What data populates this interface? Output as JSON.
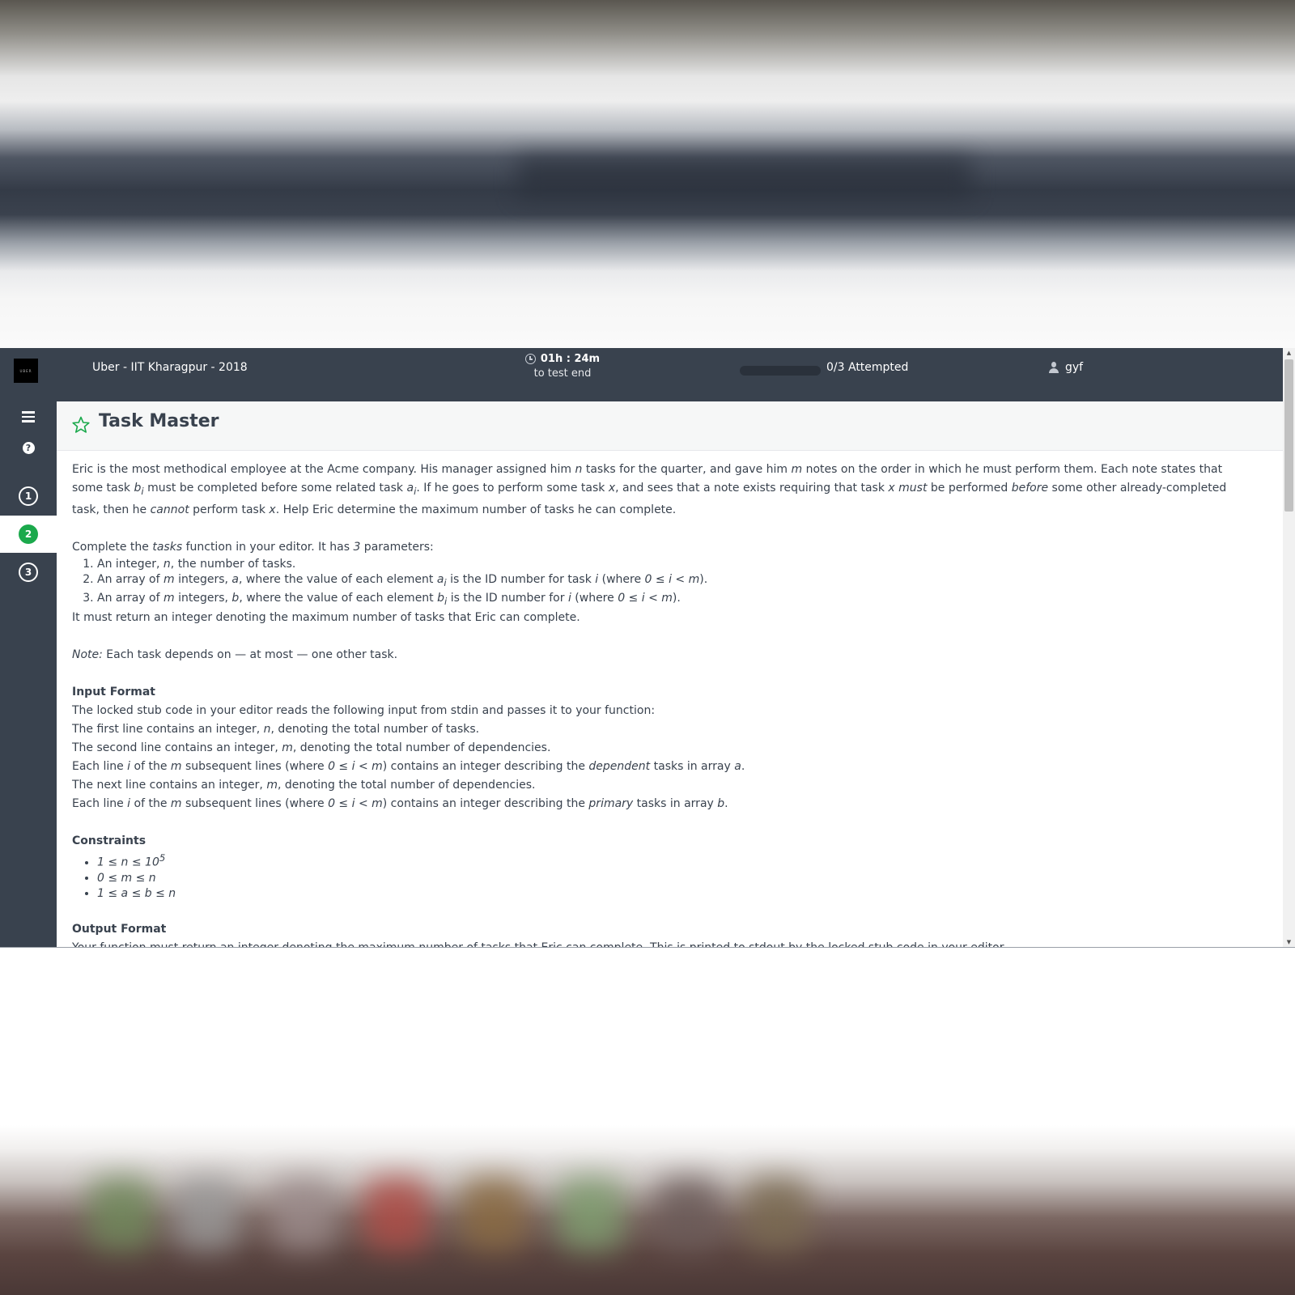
{
  "header": {
    "logo_text": "UBER",
    "contest_title": "Uber - IIT Kharagpur - 2018",
    "timer_value": "01h : 24m",
    "timer_label": "to test end",
    "progress_fraction": 0.0,
    "attempted_label": "0/3 Attempted",
    "username": "gyf"
  },
  "sidebar": {
    "questions": [
      {
        "label": "1",
        "active": false
      },
      {
        "label": "2",
        "active": true
      },
      {
        "label": "3",
        "active": false
      }
    ]
  },
  "challenge": {
    "title": "Task Master",
    "intro": {
      "t1": "Eric is the most methodical employee at the Acme company. His manager assigned him ",
      "n": "n",
      "t2": " tasks for the quarter, and gave him ",
      "m": "m",
      "t3": " notes on the order in which he must perform them. Each note states that some task ",
      "b": "b",
      "i": "i",
      "t4": " must be completed before some related task ",
      "a": "a",
      "t5": ". If he goes to perform some task ",
      "x": "x",
      "t6": ", and sees that a note exists requiring that task ",
      "must": "must",
      "t7": " be performed ",
      "before": "before",
      "t8": " some other already-completed task, then he ",
      "cannot": "cannot",
      "t9": " perform task ",
      "t10": ". Help Eric determine the maximum number of tasks he can complete."
    },
    "complete": {
      "t1": "Complete the ",
      "fn": "tasks",
      "t2": " function in your editor. It has ",
      "count": "3",
      "t3": " parameters:"
    },
    "params": {
      "p1a": "An integer, ",
      "p1b": ", the number of tasks.",
      "p2a": "An array of ",
      "p2b": " integers, ",
      "p2c": ", where the value of each element ",
      "p2d": " is the ID number for task ",
      "p2e": " (where ",
      "range": "0 ≤ i < m",
      "close": ").",
      "p3a": "An array of ",
      "p3b": " integers, ",
      "p3c": ", where the value of each element ",
      "p3d": " is the ID number for ",
      "p3e": " (where "
    },
    "returns": "It must return an integer denoting the maximum number of tasks that Eric can complete.",
    "note_label": "Note:",
    "note_text": " Each task depends on — at most — one other task.",
    "input_format": {
      "title": "Input Format",
      "l1": "The locked stub code in your editor reads the following input from stdin and passes it to your function:",
      "l2a": "The first line contains an integer, ",
      "l2b": ", denoting the total number of tasks.",
      "l3a": "The second line contains an integer, ",
      "l3b": ", denoting the total number of dependencies.",
      "l4a": "Each line ",
      "l4b": " of the ",
      "l4c": " subsequent lines (where ",
      "l4d": ") contains an integer describing the ",
      "dependent": "dependent",
      "l4e": " tasks in array ",
      "l5a": "The next line contains an integer, ",
      "l5b": ", denoting the total number of dependencies.",
      "primary": "primary",
      "period": "."
    },
    "constraints": {
      "title": "Constraints",
      "c1": "1 ≤ n ≤ 10",
      "c1_sup": "5",
      "c2": "0 ≤ m ≤ n",
      "c3": "1 ≤ a ≤ b ≤ n"
    },
    "output_format": {
      "title": "Output Format",
      "text": "Your function must return an integer denoting the maximum number of tasks that Eric can complete. This is printed to stdout by the locked stub code in your editor."
    }
  },
  "colors": {
    "topbar": "#39424e",
    "accent_green": "#1ba94c"
  }
}
